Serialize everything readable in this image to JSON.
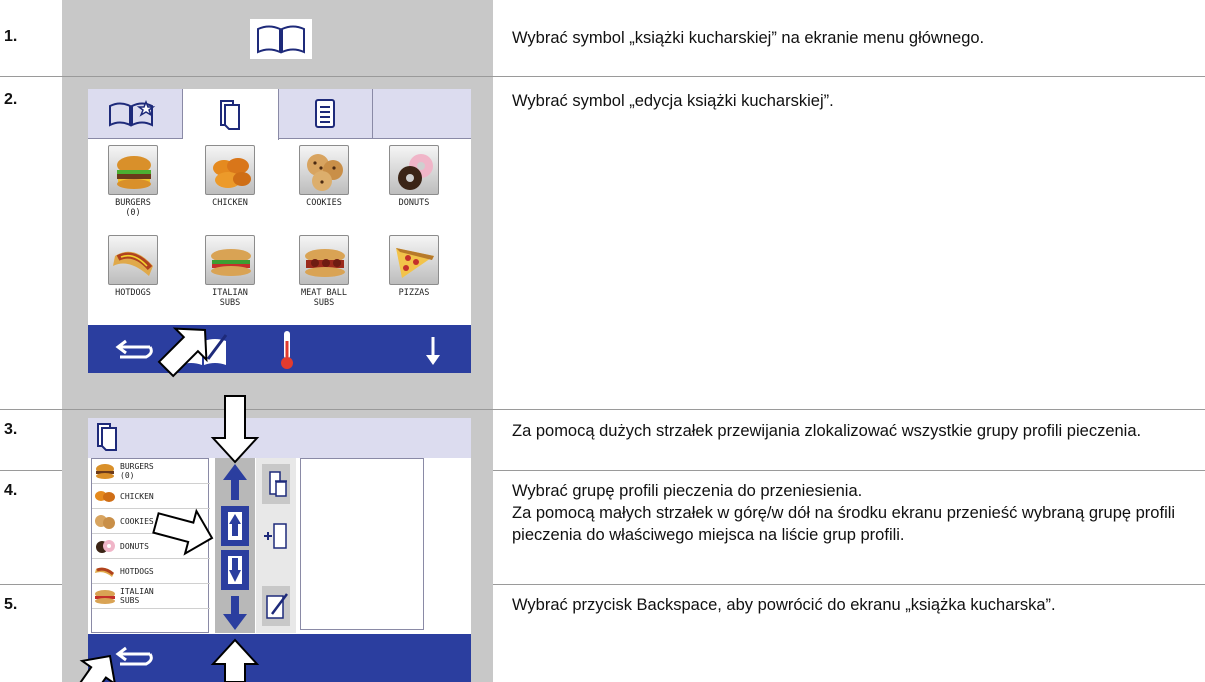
{
  "steps": [
    {
      "num": "1.",
      "text": "Wybrać symbol „książki kucharskiej” na ekranie menu głównego."
    },
    {
      "num": "2.",
      "text": "Wybrać symbol „edycja książki kucharskiej”."
    },
    {
      "num": "3.",
      "text": "Za pomocą dużych strzałek przewijania zlokalizować wszystkie grupy profili pieczenia."
    },
    {
      "num": "4.",
      "text": "Wybrać grupę profili pieczenia do przeniesienia.\nZa pomocą małych strzałek w górę/w dół na środku ekranu przenieść wybraną grupę profili pieczenia do właściwego miejsca na liście grup profili."
    },
    {
      "num": "5.",
      "text": "Wybrać przycisk Backspace, aby powrócić do ekranu „książka kucharska”."
    }
  ],
  "screen2": {
    "items": [
      {
        "label": "BURGERS\n(0)",
        "icon": "burger-icon"
      },
      {
        "label": "CHICKEN",
        "icon": "chicken-icon"
      },
      {
        "label": "COOKIES",
        "icon": "cookies-icon"
      },
      {
        "label": "DONUTS",
        "icon": "donuts-icon"
      },
      {
        "label": "HOTDOGS",
        "icon": "hotdog-icon"
      },
      {
        "label": "ITALIAN\nSUBS",
        "icon": "italian-sub-icon"
      },
      {
        "label": "MEAT BALL\nSUBS",
        "icon": "meatball-sub-icon"
      },
      {
        "label": "PIZZAS",
        "icon": "pizza-icon"
      }
    ]
  },
  "screen3": {
    "list": [
      {
        "label": "BURGERS\n(0)"
      },
      {
        "label": "CHICKEN"
      },
      {
        "label": "COOKIES"
      },
      {
        "label": "DONUTS"
      },
      {
        "label": "HOTDOGS"
      },
      {
        "label": "ITALIAN\nSUBS"
      }
    ]
  },
  "colors": {
    "bar_blue": "#2b3e9f",
    "tab_bg": "#dcdcef",
    "panel_gray": "#c8c8c8"
  }
}
